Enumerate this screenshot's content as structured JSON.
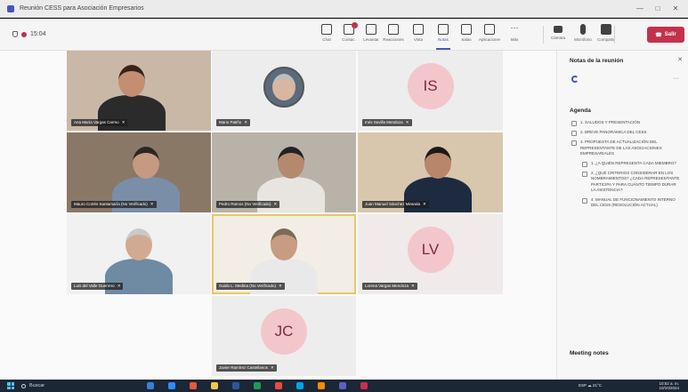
{
  "window": {
    "title": "Reunión CESS para Asociación Empresarios",
    "controls": [
      "—",
      "□",
      "✕"
    ]
  },
  "toolbar": {
    "timer": "15:04",
    "items": [
      {
        "label": "Chat",
        "icon": "chat-icon",
        "active": false,
        "badge": false
      },
      {
        "label": "Contac.",
        "icon": "people-icon",
        "active": false,
        "badge": true
      },
      {
        "label": "Levantar",
        "icon": "raise-hand-icon",
        "active": false,
        "badge": false
      },
      {
        "label": "Reacciones",
        "icon": "reactions-icon",
        "active": false,
        "badge": false
      },
      {
        "label": "Vista",
        "icon": "view-icon",
        "active": false,
        "badge": false
      },
      {
        "label": "Notas",
        "icon": "notes-icon",
        "active": true,
        "badge": false
      },
      {
        "label": "Salas",
        "icon": "rooms-icon",
        "active": false,
        "badge": false
      },
      {
        "label": "Aplicaciones",
        "icon": "apps-icon",
        "active": false,
        "badge": false
      },
      {
        "label": "Más",
        "icon": "more-icon",
        "active": false,
        "badge": false
      },
      {
        "label": "Cámara",
        "icon": "camera-icon",
        "active": false,
        "badge": false
      },
      {
        "label": "Micrófono",
        "icon": "microphone-icon",
        "active": false,
        "badge": false
      },
      {
        "label": "Compartir",
        "icon": "share-icon",
        "active": false,
        "badge": false
      }
    ],
    "leave_label": "Salir"
  },
  "participants": [
    {
      "name": "Ana María Vargas Carmo",
      "initials": "",
      "video": true,
      "speaking": false,
      "bg": "#c9b8a6",
      "skin": "#c48e72",
      "shirt": "#2b2b2b",
      "hair": "#3a2419"
    },
    {
      "name": "Mario Patiño",
      "initials": "",
      "video": false,
      "photo": true,
      "speaking": false,
      "bg": "#ededed",
      "skin": "#d8b6a0",
      "shirt": "#5b6b7c",
      "hair": "#bdbdbd"
    },
    {
      "name": "Inés Sevilla Mendoza",
      "initials": "IS",
      "video": false,
      "speaking": false,
      "bg": "#ededed",
      "avatar": "#f3c6cc"
    },
    {
      "name": "Mauro Cortés Santamaría (No Verificado)",
      "initials": "",
      "video": true,
      "speaking": false,
      "bg": "#8a7867",
      "skin": "#c69a82",
      "shirt": "#7a8ea8",
      "hair": "#2d2620"
    },
    {
      "name": "Pedro Ramos (No Verificado)",
      "initials": "",
      "video": true,
      "speaking": false,
      "bg": "#b9b2a8",
      "skin": "#b48a6f",
      "shirt": "#e8e5e0",
      "hair": "#222"
    },
    {
      "name": "Juan Manuel Sánchez Miranda",
      "initials": "",
      "video": true,
      "speaking": false,
      "bg": "#d8c7ad",
      "skin": "#b88668",
      "shirt": "#1e2a40",
      "hair": "#1d1a18"
    },
    {
      "name": "Luis del Valle Guerrero",
      "initials": "",
      "video": true,
      "speaking": false,
      "bg": "#f1f1f1",
      "skin": "#d2a991",
      "shirt": "#6f8aa3",
      "hair": "#c9c9c9"
    },
    {
      "name": "Guido L. Medina (No Verificado)",
      "initials": "",
      "video": true,
      "speaking": true,
      "bg": "#f2eee6",
      "skin": "#c89c82",
      "shirt": "#e9e9e9",
      "hair": "#7d6a59"
    },
    {
      "name": "Lorena Vargas Mendoza",
      "initials": "LV",
      "video": false,
      "speaking": false,
      "bg": "#f0eaea",
      "avatar": "#f3c6cc"
    },
    {
      "name": "Javier Ramírez Castellanos",
      "initials": "JC",
      "video": false,
      "speaking": false,
      "bg": "#ededed",
      "avatar": "#f3c6cc"
    }
  ],
  "notes": {
    "panel_title": "Notas de la reunión",
    "agenda_title": "Agenda",
    "agenda": [
      {
        "text": "1. Saludos y presentación",
        "sub": false
      },
      {
        "text": "2. Breve panorámica del CESS",
        "sub": false
      },
      {
        "text": "3. Propuesta de actualización del representante de las asociaciones empresariales",
        "sub": false
      },
      {
        "text": "1. ¿A quién representa cada miembro?",
        "sub": true
      },
      {
        "text": "2. ¿Qué criterios considerar en los nombramientos? ¿Cada representante participa y para cuánto tiempo durar la asistencia?",
        "sub": true
      },
      {
        "text": "4. Manual de funcionamiento interno del CESS (resolución actual)",
        "sub": true
      }
    ],
    "meeting_notes_title": "Meeting notes"
  },
  "taskbar": {
    "search_label": "Buscar",
    "tray_text": "ESP  ☁ 21°C",
    "time": "10:52 a. m.",
    "date": "10/10/2024",
    "apps": [
      "#3b7ddd",
      "#2d8cff",
      "#e35b3a",
      "#f2c94c",
      "#2b579a",
      "#1d9b55",
      "#e74c3c",
      "#00a4ef",
      "#ff8c00",
      "#5b5fc7",
      "#c4314b"
    ]
  }
}
